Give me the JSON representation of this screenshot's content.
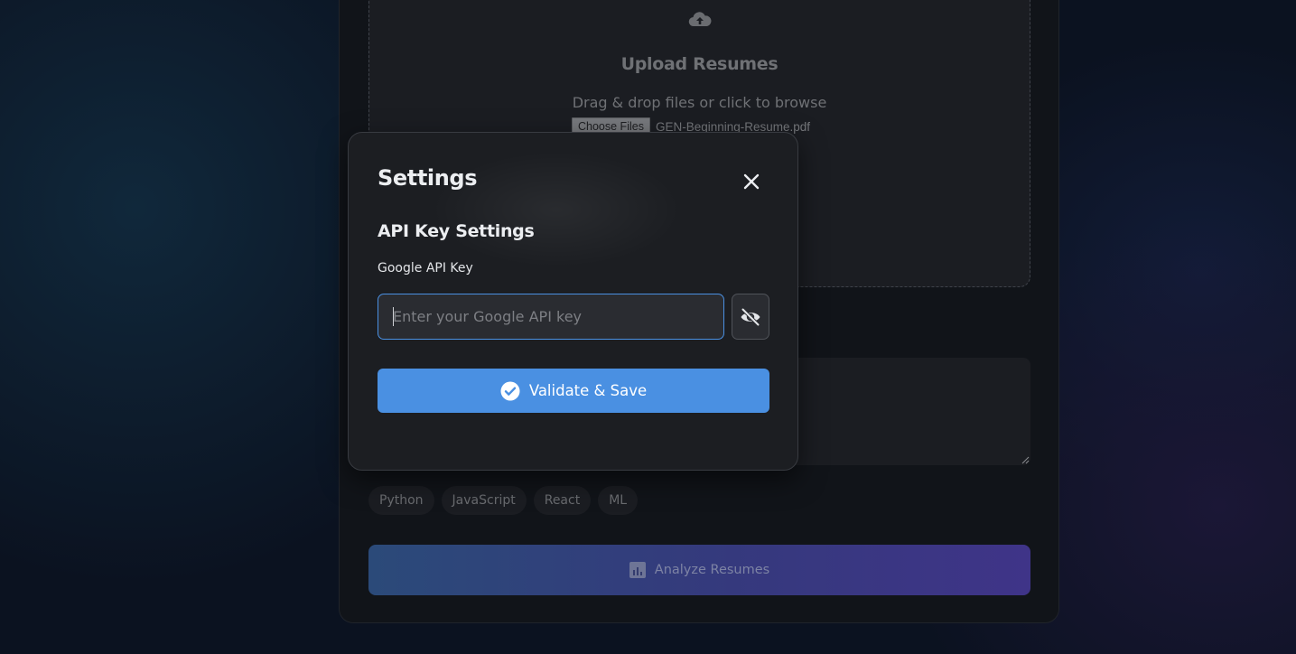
{
  "upload": {
    "title": "Upload Resumes",
    "subtitle": "Drag & drop files or click to browse",
    "choose_files_label": "Choose Files",
    "selected_file": "GEN-Beginning-Resume.pdf",
    "icon": "cloud-upload-icon"
  },
  "skills": {
    "tags": [
      "Python",
      "JavaScript",
      "React",
      "ML"
    ]
  },
  "analyze": {
    "label": "Analyze Resumes",
    "icon": "chart-icon"
  },
  "settings_modal": {
    "title": "Settings",
    "close_icon": "close-icon",
    "section_title": "API Key Settings",
    "api_key_label": "Google API Key",
    "api_key_value": "",
    "api_key_placeholder": "Enter your Google API key",
    "toggle_icon": "eye-slash-icon",
    "validate_label": "Validate & Save",
    "validate_icon": "check-circle-icon"
  },
  "colors": {
    "accent": "#4a90e2",
    "modal_bg": "#1c1e22",
    "page_bg": "#0b1220"
  }
}
